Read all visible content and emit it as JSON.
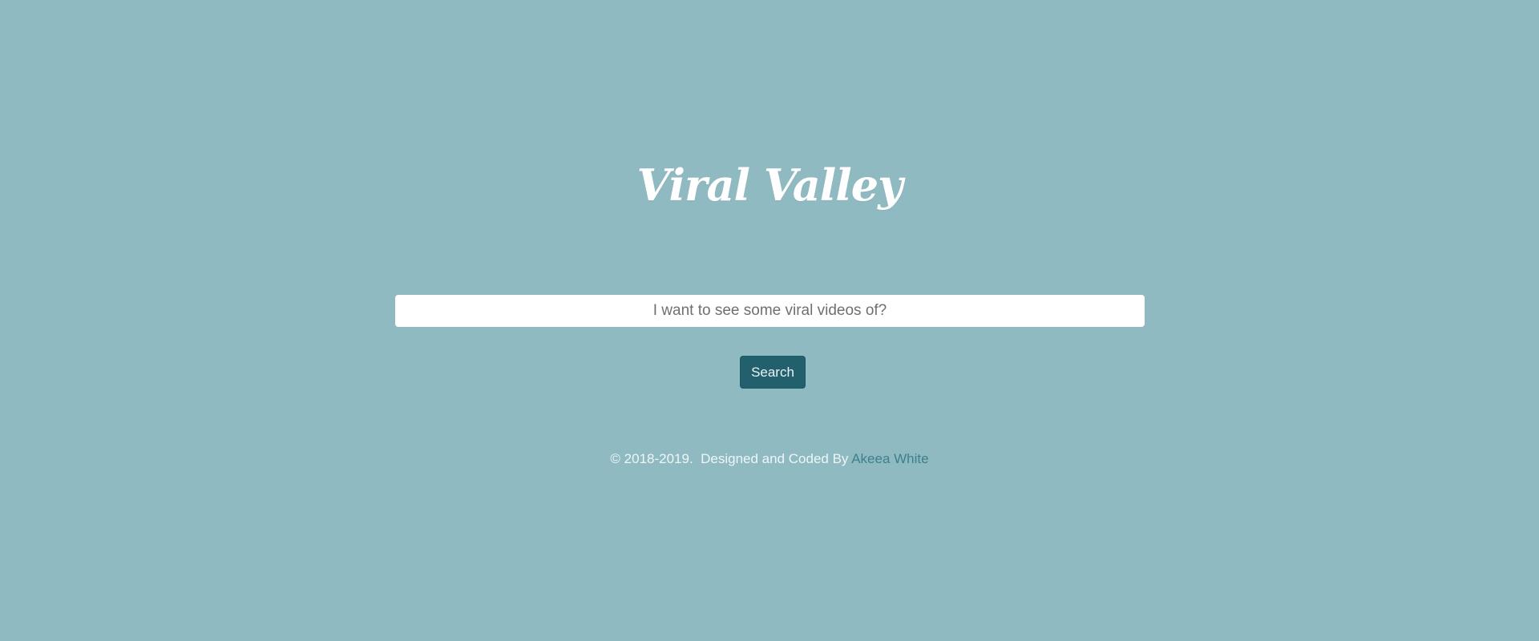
{
  "app": {
    "title": "Viral Valley"
  },
  "search": {
    "placeholder": "I want to see some viral videos of?",
    "value": "",
    "button_label": "Search"
  },
  "footer": {
    "copyright": "© 2018-2019.  Designed and Coded By ",
    "author_link": "Akeea White"
  },
  "colors": {
    "background": "#90bac2",
    "button": "#23606e",
    "link": "#3d7f8b",
    "title": "#ffffff"
  }
}
